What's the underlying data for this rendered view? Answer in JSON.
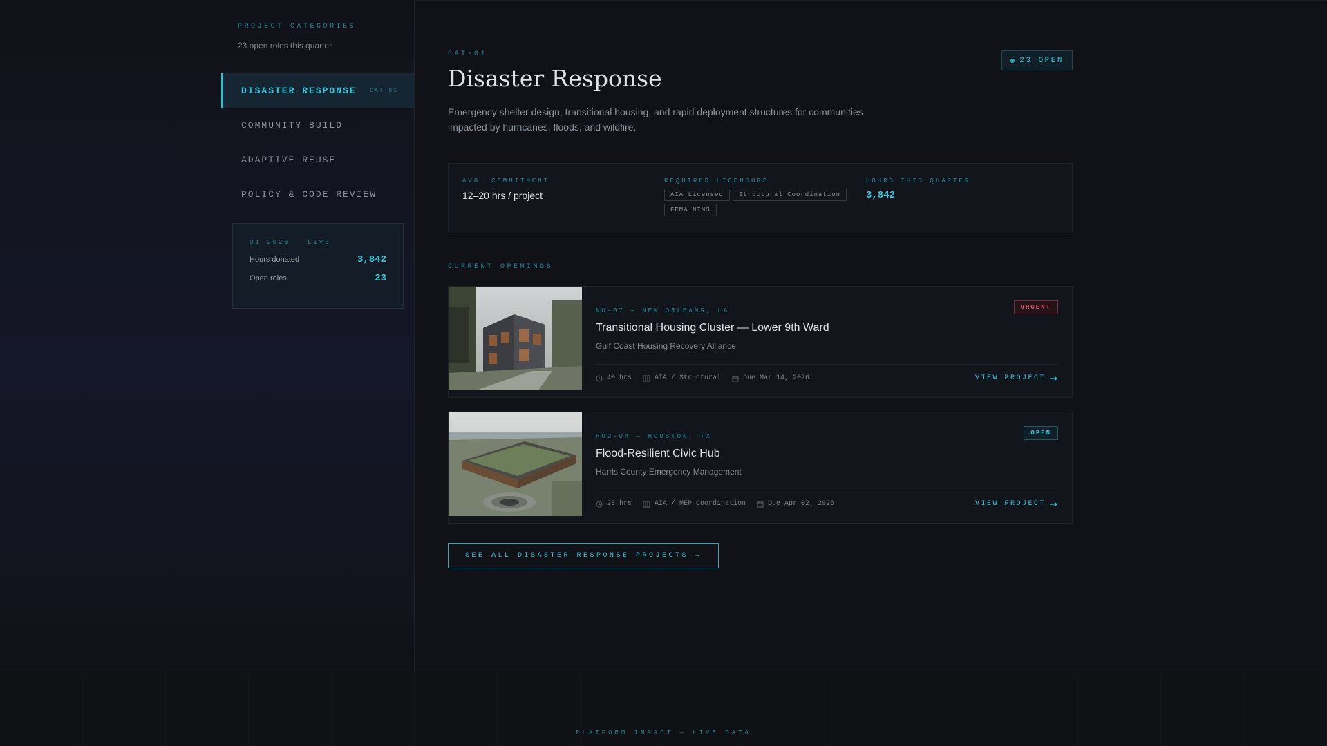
{
  "sidebar": {
    "heading": "PROJECT CATEGORIES",
    "subheading": "23 open roles this quarter",
    "items": [
      {
        "label": "DISASTER RESPONSE",
        "badge": "CAT-01",
        "active": true
      },
      {
        "label": "COMMUNITY BUILD"
      },
      {
        "label": "ADAPTIVE REUSE"
      },
      {
        "label": "POLICY & CODE REVIEW"
      }
    ],
    "stats": {
      "label": "Q1 2026 — LIVE",
      "hours_label": "Hours donated",
      "hours_value": "3,842",
      "roles_label": "Open roles",
      "roles_value": "23"
    }
  },
  "main": {
    "category_id": "CAT-01",
    "open_pill": "23 OPEN",
    "title": "Disaster Response",
    "description": "Emergency shelter design, transitional housing, and rapid deployment structures for communities impacted by hurricanes, floods, and wildfire.",
    "info": {
      "commitment_label": "AVG. COMMITMENT",
      "commitment_value": "12–20 hrs / project",
      "licensure_label": "REQUIRED LICENSURE",
      "licensure_tags": [
        "AIA Licensed",
        "Structural Coordination",
        "FEMA NIMS"
      ],
      "hours_label": "HOURS THIS QUARTER",
      "hours_value": "3,842"
    },
    "section_label": "CURRENT OPENINGS",
    "openings": [
      {
        "code": "NO-07 — NEW ORLEANS, LA",
        "title": "Transitional Housing Cluster — Lower 9th Ward",
        "org": "Gulf Coast Housing Recovery Alliance",
        "badge": "URGENT",
        "hours": "40 hrs",
        "discipline": "AIA / Structural",
        "due": "Due Mar 14, 2026",
        "link": "VIEW PROJECT"
      },
      {
        "code": "HOU-04 — HOUSTON, TX",
        "title": "Flood-Resilient Civic Hub",
        "org": "Harris County Emergency Management",
        "badge": "OPEN",
        "hours": "28 hrs",
        "discipline": "AIA / MEP Coordination",
        "due": "Due Apr 02, 2026",
        "link": "VIEW PROJECT"
      }
    ],
    "see_all": "SEE ALL DISASTER RESPONSE PROJECTS →"
  },
  "footer": {
    "label": "PLATFORM IMPACT — LIVE DATA"
  },
  "icons": {
    "clock": "clock-icon",
    "building": "building-icon",
    "calendar": "calendar-icon",
    "arrow": "arrow-right-icon"
  }
}
